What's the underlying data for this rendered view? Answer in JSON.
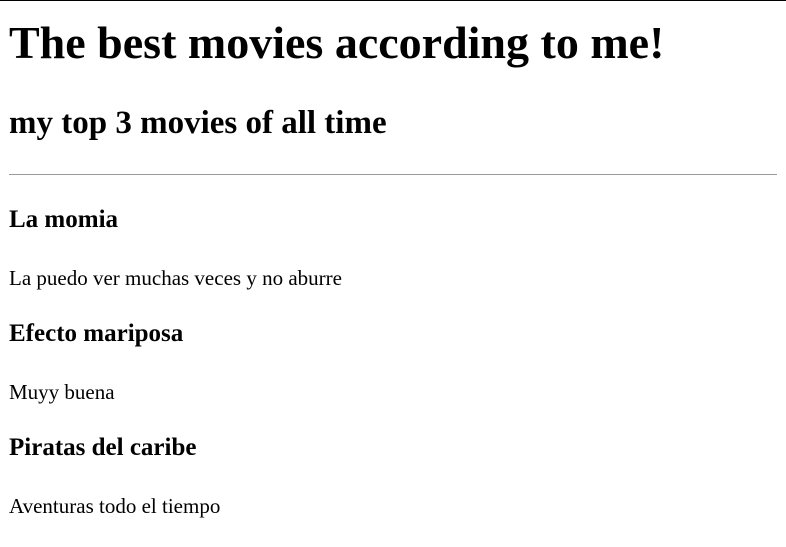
{
  "page": {
    "title": "The best movies according to me!",
    "subtitle": "my top 3 movies of all time"
  },
  "movies": [
    {
      "title": "La momia",
      "description": "La puedo ver muchas veces y no aburre"
    },
    {
      "title": "Efecto mariposa",
      "description": "Muyy buena"
    },
    {
      "title": "Piratas del caribe",
      "description": "Aventuras todo el tiempo"
    }
  ]
}
